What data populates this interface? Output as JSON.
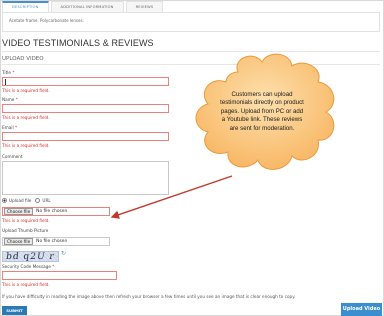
{
  "tabs": [
    {
      "label": "DESCRIPTION",
      "active": true
    },
    {
      "label": "ADDITIONAL INFORMATION",
      "active": false
    },
    {
      "label": "REVIEWS",
      "active": false
    }
  ],
  "tab_content": "Acetate frame. Polycarbonate lenses.",
  "section": {
    "title": "VIDEO TESTIMONIALS & REVIEWS",
    "subtitle": "UPLOAD VIDEO"
  },
  "form": {
    "title_label": "Title",
    "name_label": "Name",
    "email_label": "Email",
    "comment_label": "Comment",
    "required_marker": "*",
    "error_text": "This is a required field.",
    "upload_options": [
      "Upload file",
      "URL"
    ],
    "file_button": "Choose file",
    "no_file": "No file chosen",
    "thumb_label": "Upload Thumb Picture",
    "captcha_text": "bd q2U r",
    "security_label": "Security Code Message",
    "note": "If you have difficulty in reading the image above then refresh your browser a few times until you see an image that is clear enough to copy.",
    "submit_label": "SUBMIT",
    "upload_video_label": "Upload Video"
  },
  "callout": {
    "lines": [
      "Customers can upload",
      "testimonials directly on product",
      "pages. Upload from PC or add",
      "a Youtube link. These reviews",
      "are sent for moderation."
    ],
    "fill": "#fbc77a",
    "stroke": "#f0a347",
    "arrow_color": "#c0392b"
  },
  "colors": {
    "accent": "#4a90c8",
    "error": "#e02b27",
    "button": "#2a7ab5"
  }
}
